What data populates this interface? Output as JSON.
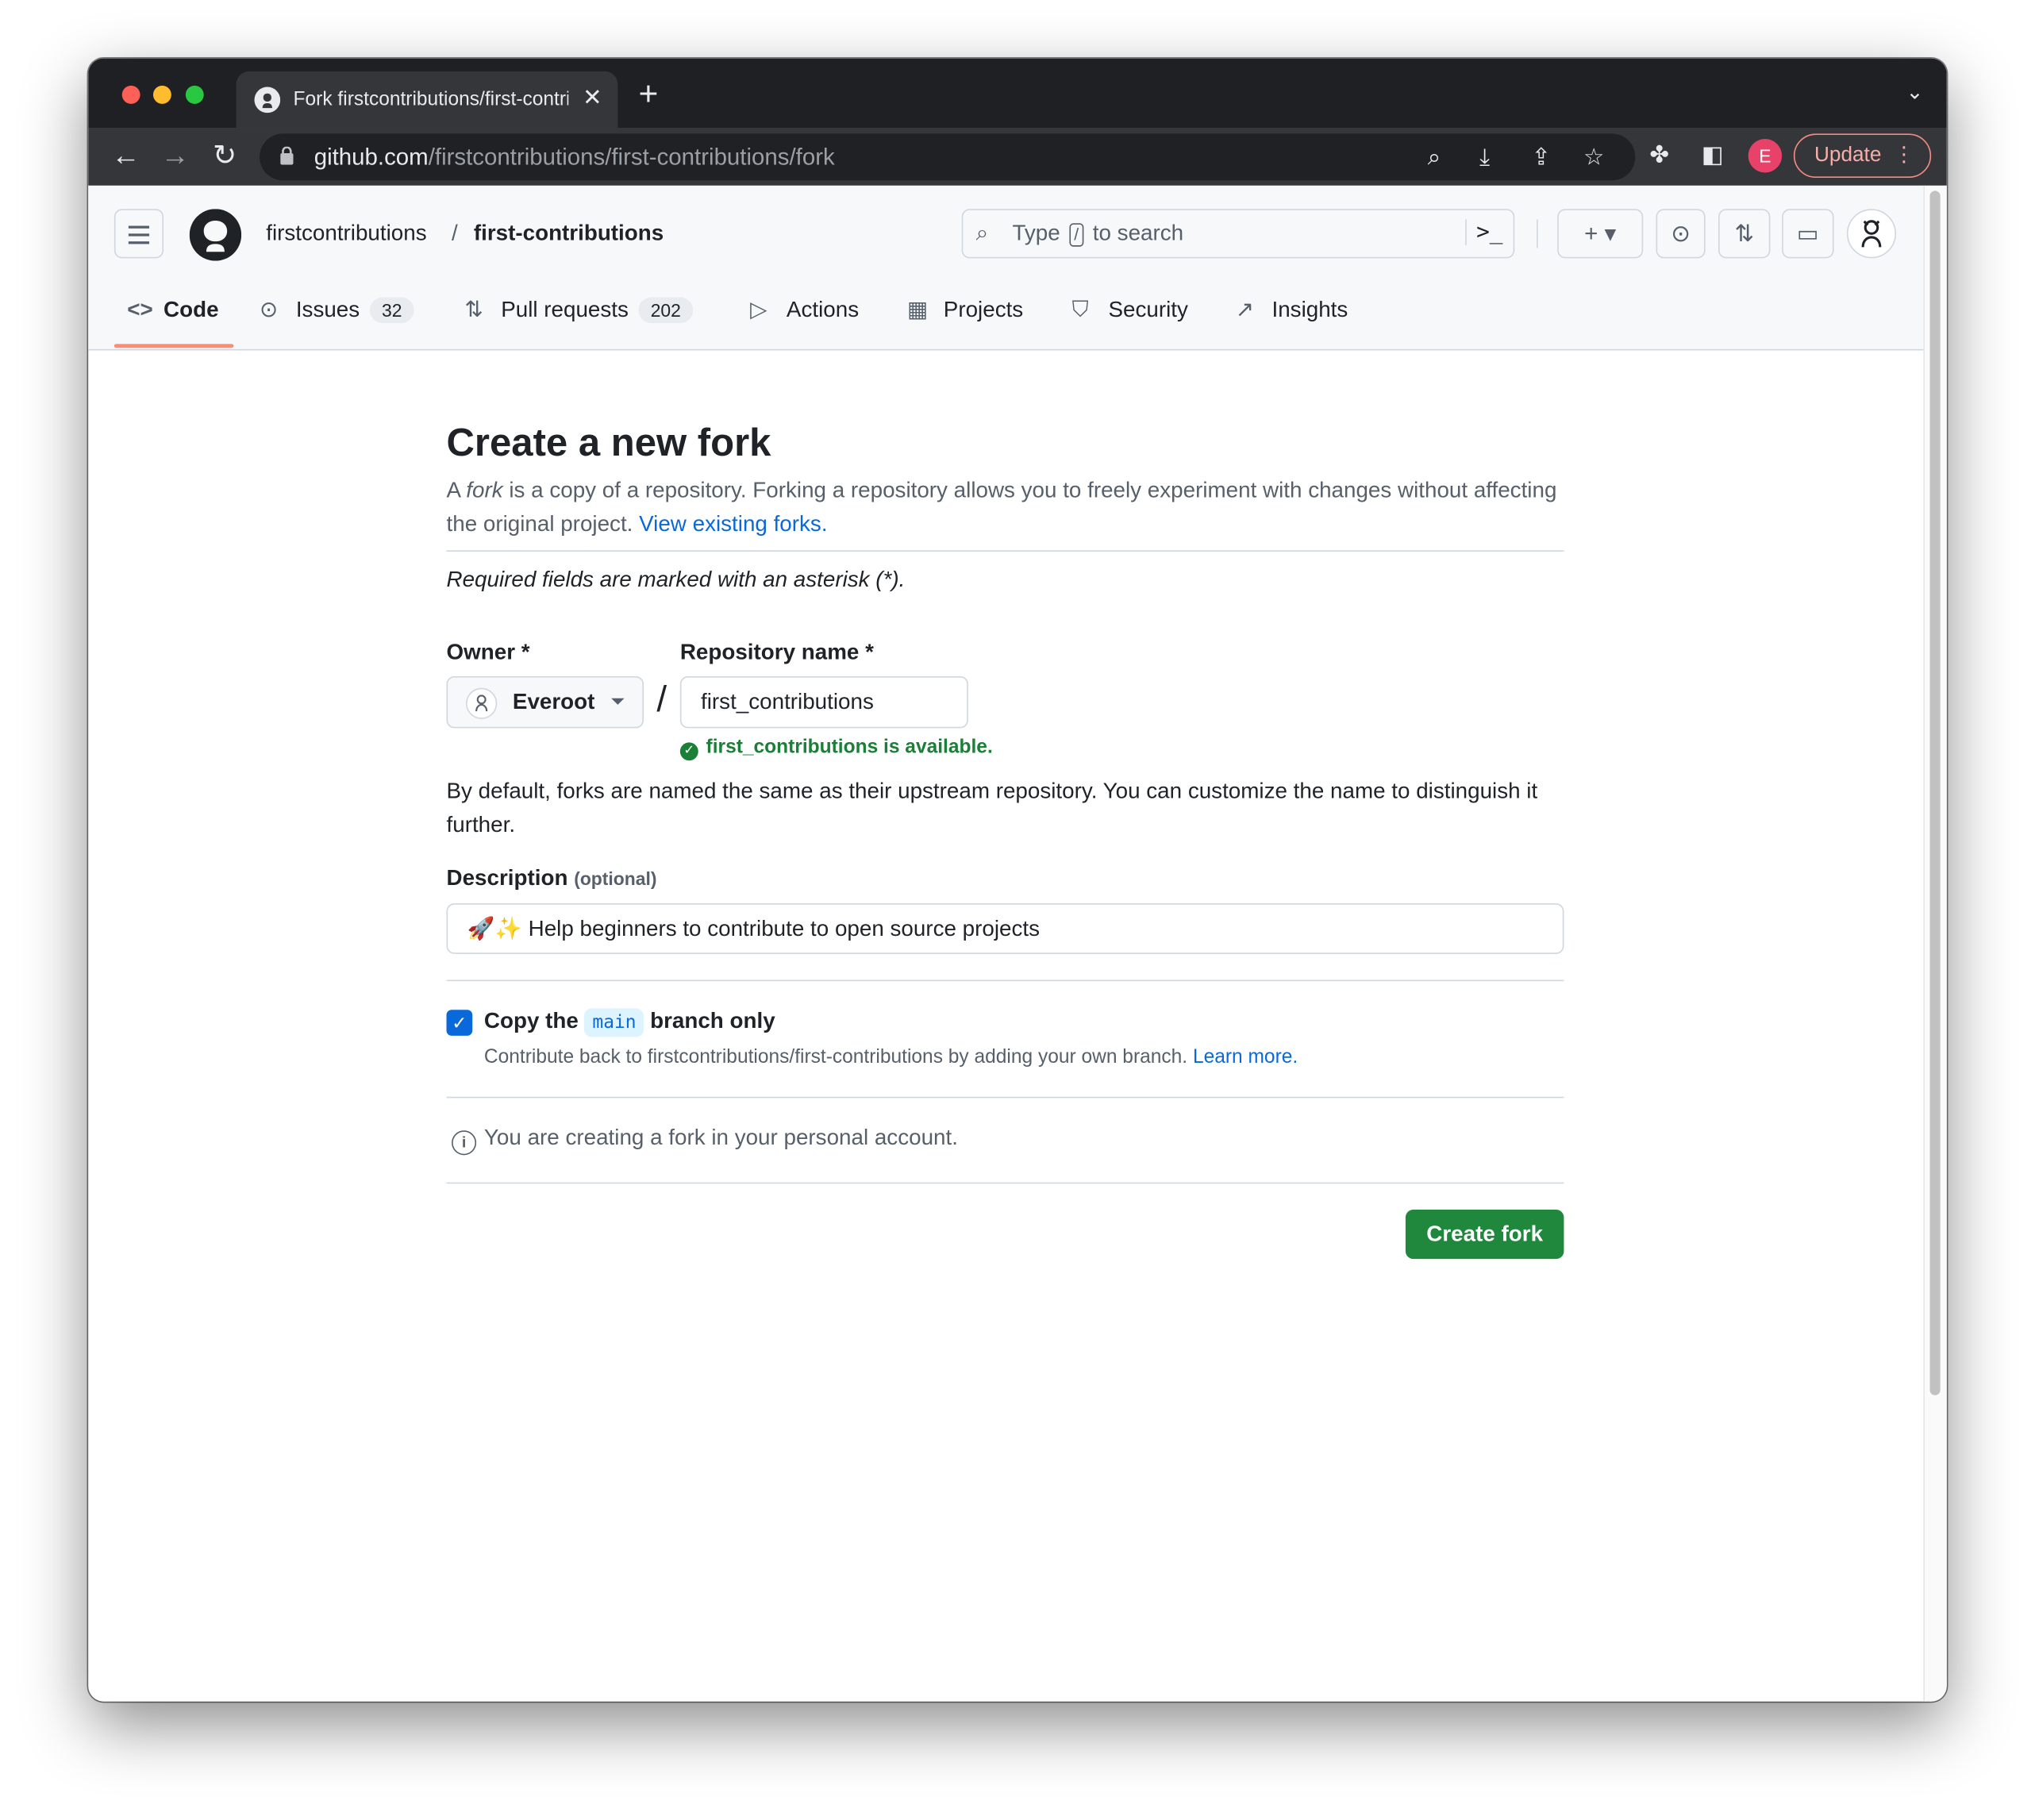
{
  "browser": {
    "tab_title": "Fork firstcontributions/first-contributions",
    "url_host": "github.com",
    "url_path": "/firstcontributions/first-contributions/fork",
    "profile_initial": "E",
    "update_label": "Update"
  },
  "header": {
    "owner": "firstcontributions",
    "separator": "/",
    "repo": "first-contributions",
    "search_prefix": "Type",
    "search_key": "/",
    "search_suffix": "to search"
  },
  "repo_nav": {
    "tabs": [
      {
        "label": "Code",
        "active": true
      },
      {
        "label": "Issues",
        "count": "32"
      },
      {
        "label": "Pull requests",
        "count": "202"
      },
      {
        "label": "Actions"
      },
      {
        "label": "Projects"
      },
      {
        "label": "Security"
      },
      {
        "label": "Insights"
      }
    ]
  },
  "form": {
    "title": "Create a new fork",
    "lead_a": "A",
    "lead_fork": "fork",
    "lead_rest": "is a copy of a repository. Forking a repository allows you to freely experiment with changes without affecting the original project.",
    "lead_link": "View existing forks.",
    "required_note": "Required fields are marked with an asterisk (*).",
    "owner_label": "Owner *",
    "owner_value": "Everoot",
    "repo_label": "Repository name *",
    "repo_value": "first_contributions",
    "availability": "first_contributions is available.",
    "naming_help": "By default, forks are named the same as their upstream repository. You can customize the name to distinguish it further.",
    "description_label": "Description",
    "description_optional": "(optional)",
    "description_value": "🚀✨ Help beginners to contribute to open source projects",
    "copy_prefix": "Copy the",
    "copy_branch": "main",
    "copy_suffix": "branch only",
    "copy_checked": true,
    "copy_note": "Contribute back to firstcontributions/first-contributions by adding your own branch.",
    "copy_learn_more": "Learn more.",
    "account_info": "You are creating a fork in your personal account.",
    "submit_label": "Create fork"
  },
  "colors": {
    "accent_link": "#0969da",
    "success": "#1a7f37",
    "primary_button": "#1f883d",
    "active_tab_underline": "#fd8c73"
  }
}
